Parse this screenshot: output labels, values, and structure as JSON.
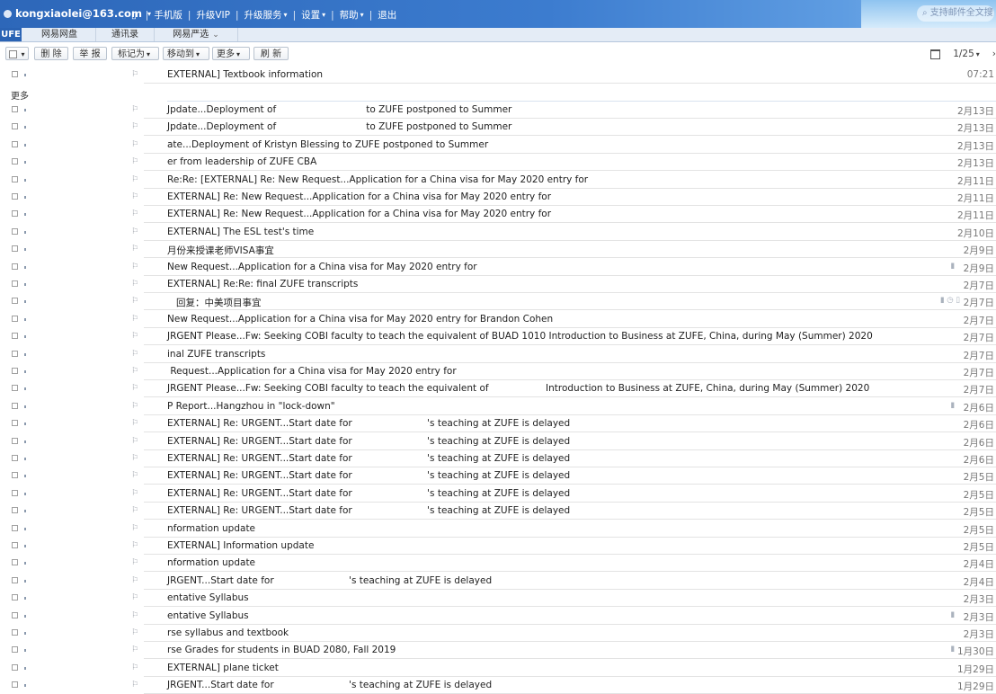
{
  "topbar": {
    "user": "kongxiaolei@163.com",
    "links": [
      "手机版",
      "升级VIP",
      "升级服务",
      "设置",
      "帮助",
      "退出"
    ],
    "search_placeholder": "支持邮件全文搜索"
  },
  "tabs": [
    {
      "label": "UFE",
      "active": true
    },
    {
      "label": "网易网盘",
      "active": false
    },
    {
      "label": "通讯录",
      "active": false
    },
    {
      "label": "网易严选",
      "active": false
    }
  ],
  "toolbar": {
    "delete": "删 除",
    "report": "举 报",
    "mark_as": "标记为",
    "move_to": "移动到",
    "more": "更多",
    "refresh": "刷 新",
    "pagination": "1/25"
  },
  "more_label": "更多",
  "emails": [
    {
      "subject": "EXTERNAL] Textbook information",
      "date": "07:21"
    },
    {
      "subject": "Jpdate...Deployment of                              to ZUFE postponed to Summer",
      "date": "2月13日"
    },
    {
      "subject": "Jpdate...Deployment of                              to ZUFE postponed to Summer",
      "date": "2月13日"
    },
    {
      "subject": "ate...Deployment of Kristyn Blessing to ZUFE postponed to Summer",
      "date": "2月13日"
    },
    {
      "subject": "er from leadership of ZUFE CBA",
      "date": "2月13日"
    },
    {
      "subject": "Re:Re: [EXTERNAL] Re: New Request...Application for a China visa for May 2020 entry for",
      "date": "2月11日"
    },
    {
      "subject": "EXTERNAL] Re: New Request...Application for a China visa for May 2020 entry for",
      "date": "2月11日"
    },
    {
      "subject": "EXTERNAL] Re: New Request...Application for a China visa for May 2020 entry for",
      "date": "2月11日"
    },
    {
      "subject": "EXTERNAL] The ESL test's time",
      "date": "2月10日"
    },
    {
      "subject": "月份来授课老师VISA事宜",
      "date": "2月9日"
    },
    {
      "subject": "New Request...Application for a China visa for May 2020 entry for",
      "date": "2月9日",
      "has_attachment": true
    },
    {
      "subject": "EXTERNAL] Re:Re: final ZUFE transcripts",
      "date": "2月7日"
    },
    {
      "subject": "回复：中美项目事宜",
      "date": "2月7日",
      "has_flag_icons": true
    },
    {
      "subject": "New Request...Application for a China visa for May 2020 entry for Brandon Cohen",
      "date": "2月7日"
    },
    {
      "subject": "JRGENT Please...Fw: Seeking COBI faculty to teach the equivalent of BUAD 1010 Introduction to Business at ZUFE, China, during May (Summer) 2020",
      "date": "2月7日"
    },
    {
      "subject": "inal ZUFE transcripts",
      "date": "2月7日"
    },
    {
      "subject": " Request...Application for a China visa for May 2020 entry for",
      "date": "2月7日"
    },
    {
      "subject": "JRGENT Please...Fw: Seeking COBI faculty to teach the equivalent of                   Introduction to Business at ZUFE, China, during May (Summer) 2020",
      "date": "2月7日"
    },
    {
      "subject": "P Report...Hangzhou in \"lock-down\"",
      "date": "2月6日",
      "has_attachment": true
    },
    {
      "subject": "EXTERNAL] Re: URGENT...Start date for                         's teaching at ZUFE is delayed",
      "date": "2月6日"
    },
    {
      "subject": "EXTERNAL] Re: URGENT...Start date for                         's teaching at ZUFE is delayed",
      "date": "2月6日"
    },
    {
      "subject": "EXTERNAL] Re: URGENT...Start date for                         's teaching at ZUFE is delayed",
      "date": "2月6日"
    },
    {
      "subject": "EXTERNAL] Re: URGENT...Start date for                         's teaching at ZUFE is delayed",
      "date": "2月5日"
    },
    {
      "subject": "EXTERNAL] Re: URGENT...Start date for                         's teaching at ZUFE is delayed",
      "date": "2月5日"
    },
    {
      "subject": "EXTERNAL] Re: URGENT...Start date for                         's teaching at ZUFE is delayed",
      "date": "2月5日"
    },
    {
      "subject": "nformation update",
      "date": "2月5日"
    },
    {
      "subject": "EXTERNAL] Information update",
      "date": "2月5日"
    },
    {
      "subject": "nformation update",
      "date": "2月4日"
    },
    {
      "subject": "JRGENT...Start date for                         's teaching at ZUFE is delayed",
      "date": "2月4日"
    },
    {
      "subject": "entative Syllabus",
      "date": "2月3日"
    },
    {
      "subject": "entative Syllabus",
      "date": "2月3日",
      "has_attachment": true
    },
    {
      "subject": "rse syllabus and textbook",
      "date": "2月3日"
    },
    {
      "subject": "rse Grades for students in BUAD 2080, Fall 2019",
      "date": "1月30日",
      "has_attachment": true
    },
    {
      "subject": "EXTERNAL] plane ticket",
      "date": "1月29日"
    },
    {
      "subject": "JRGENT...Start date for                         's teaching at ZUFE is delayed",
      "date": "1月29日"
    }
  ]
}
